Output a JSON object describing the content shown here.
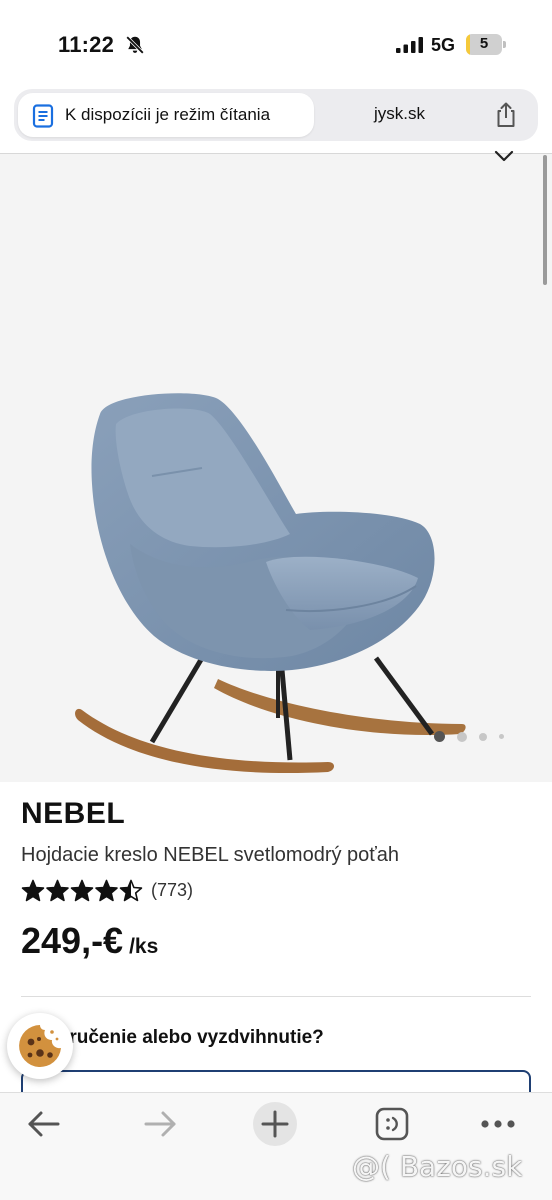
{
  "status_bar": {
    "time": "11:22",
    "network": "5G",
    "battery_level": "5",
    "battery_fraction": 0.05,
    "icons": [
      "bell-slash-icon",
      "signal-icon",
      "battery-icon"
    ]
  },
  "browser": {
    "reader_mode_label": "K dispozícii je režim čítania",
    "domain": "jysk.sk",
    "icons": [
      "reader-mode-icon",
      "share-icon"
    ]
  },
  "gallery": {
    "image_count": 4,
    "active_index": 0,
    "icons": [
      "chevron-down-icon"
    ]
  },
  "product": {
    "name": "NEBEL",
    "description": "Hojdacie kreslo NEBEL svetlomodrý poťah",
    "rating": 4.5,
    "rating_max": 5,
    "review_count": "(773)",
    "price": "249,-€",
    "price_unit": "/ks"
  },
  "delivery": {
    "heading": "Doručenie alebo vyzdvihnutie?"
  },
  "cookie": {
    "icon": "cookie-icon"
  },
  "toolbar": {
    "icons": [
      "back-arrow-icon",
      "forward-arrow-icon",
      "new-tab-icon",
      "tabs-icon",
      "more-icon"
    ]
  },
  "watermark": {
    "text": "@( Bazos.sk"
  },
  "colors": {
    "accent_border": "#1f3f73",
    "battery": "#f5c93a",
    "image_background": "#f4f4f4",
    "text": "#111111"
  }
}
